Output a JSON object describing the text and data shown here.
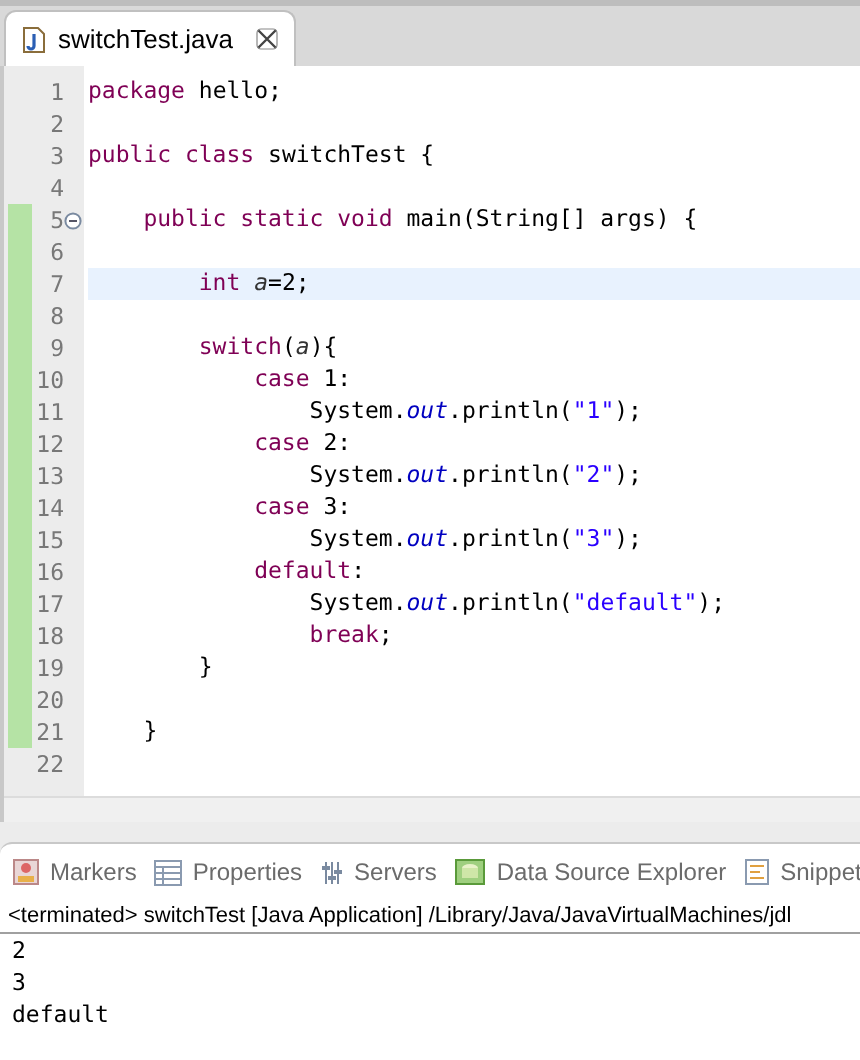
{
  "editor_tab": {
    "title": "switchTest.java",
    "selected": true
  },
  "code_lines": [
    {
      "number": "1",
      "changed": false,
      "current": false,
      "fold": false,
      "tokens": [
        {
          "t": "package",
          "kind": "kw"
        },
        {
          "t": " hello;",
          "kind": "plain"
        }
      ]
    },
    {
      "number": "2",
      "changed": false,
      "current": false,
      "fold": false
    },
    {
      "number": "3",
      "changed": false,
      "current": false,
      "fold": false,
      "tokens": [
        {
          "t": "public class",
          "kind": "kw"
        },
        {
          "t": " switchTest {",
          "kind": "plain"
        }
      ]
    },
    {
      "number": "4",
      "changed": false,
      "current": false,
      "fold": false
    },
    {
      "number": "5",
      "changed": true,
      "current": false,
      "fold": true,
      "tokens": [
        {
          "t": "    public static void",
          "kind": "kw"
        },
        {
          "t": " main(String[] args) {",
          "kind": "plain"
        }
      ]
    },
    {
      "number": "6",
      "changed": true,
      "current": false,
      "fold": false
    },
    {
      "number": "7",
      "changed": true,
      "current": true,
      "fold": false,
      "tokens": [
        {
          "t": "        int ",
          "kind": "kw"
        },
        {
          "t": "a",
          "kind": "local"
        },
        {
          "t": "=2;",
          "kind": "plain"
        }
      ]
    },
    {
      "number": "8",
      "changed": true,
      "current": false,
      "fold": false
    },
    {
      "number": "9",
      "changed": true,
      "current": false,
      "fold": false,
      "tokens": [
        {
          "t": "        switch",
          "kind": "kw"
        },
        {
          "t": "(",
          "kind": "plain"
        },
        {
          "t": "a",
          "kind": "local"
        },
        {
          "t": "){",
          "kind": "plain"
        }
      ]
    },
    {
      "number": "10",
      "changed": true,
      "current": false,
      "fold": false,
      "tokens": [
        {
          "t": "            case",
          "kind": "kw"
        },
        {
          "t": " 1:",
          "kind": "plain"
        }
      ]
    },
    {
      "number": "11",
      "changed": true,
      "current": false,
      "fold": false,
      "tokens": [
        {
          "t": "                System.",
          "kind": "plain"
        },
        {
          "t": "out",
          "kind": "field"
        },
        {
          "t": ".println(",
          "kind": "plain"
        },
        {
          "t": "\"1\"",
          "kind": "str"
        },
        {
          "t": ");",
          "kind": "plain"
        }
      ]
    },
    {
      "number": "12",
      "changed": true,
      "current": false,
      "fold": false,
      "tokens": [
        {
          "t": "            case",
          "kind": "kw"
        },
        {
          "t": " 2:",
          "kind": "plain"
        }
      ]
    },
    {
      "number": "13",
      "changed": true,
      "current": false,
      "fold": false,
      "tokens": [
        {
          "t": "                System.",
          "kind": "plain"
        },
        {
          "t": "out",
          "kind": "field"
        },
        {
          "t": ".println(",
          "kind": "plain"
        },
        {
          "t": "\"2\"",
          "kind": "str"
        },
        {
          "t": ");",
          "kind": "plain"
        }
      ]
    },
    {
      "number": "14",
      "changed": true,
      "current": false,
      "fold": false,
      "tokens": [
        {
          "t": "            case",
          "kind": "kw"
        },
        {
          "t": " 3:",
          "kind": "plain"
        }
      ]
    },
    {
      "number": "15",
      "changed": true,
      "current": false,
      "fold": false,
      "tokens": [
        {
          "t": "                System.",
          "kind": "plain"
        },
        {
          "t": "out",
          "kind": "field"
        },
        {
          "t": ".println(",
          "kind": "plain"
        },
        {
          "t": "\"3\"",
          "kind": "str"
        },
        {
          "t": ");",
          "kind": "plain"
        }
      ]
    },
    {
      "number": "16",
      "changed": true,
      "current": false,
      "fold": false,
      "tokens": [
        {
          "t": "            default",
          "kind": "kw"
        },
        {
          "t": ":",
          "kind": "plain"
        }
      ]
    },
    {
      "number": "17",
      "changed": true,
      "current": false,
      "fold": false,
      "tokens": [
        {
          "t": "                System.",
          "kind": "plain"
        },
        {
          "t": "out",
          "kind": "field"
        },
        {
          "t": ".println(",
          "kind": "plain"
        },
        {
          "t": "\"default\"",
          "kind": "str"
        },
        {
          "t": ");",
          "kind": "plain"
        }
      ]
    },
    {
      "number": "18",
      "changed": true,
      "current": false,
      "fold": false,
      "tokens": [
        {
          "t": "                break",
          "kind": "kw"
        },
        {
          "t": ";",
          "kind": "plain"
        }
      ]
    },
    {
      "number": "19",
      "changed": true,
      "current": false,
      "fold": false,
      "tokens": [
        {
          "t": "        }",
          "kind": "plain"
        }
      ]
    },
    {
      "number": "20",
      "changed": true,
      "current": false,
      "fold": false
    },
    {
      "number": "21",
      "changed": true,
      "current": false,
      "fold": false,
      "tokens": [
        {
          "t": "    }",
          "kind": "plain"
        }
      ]
    },
    {
      "number": "22",
      "changed": false,
      "current": false,
      "fold": false
    }
  ],
  "view_tabs": [
    {
      "label": "Markers"
    },
    {
      "label": "Properties"
    },
    {
      "label": "Servers"
    },
    {
      "label": "Data Source Explorer"
    },
    {
      "label": "Snippet"
    }
  ],
  "console": {
    "header": "<terminated> switchTest [Java Application] /Library/Java/JavaVirtualMachines/jdl",
    "output": [
      "2",
      "3",
      "default"
    ]
  }
}
